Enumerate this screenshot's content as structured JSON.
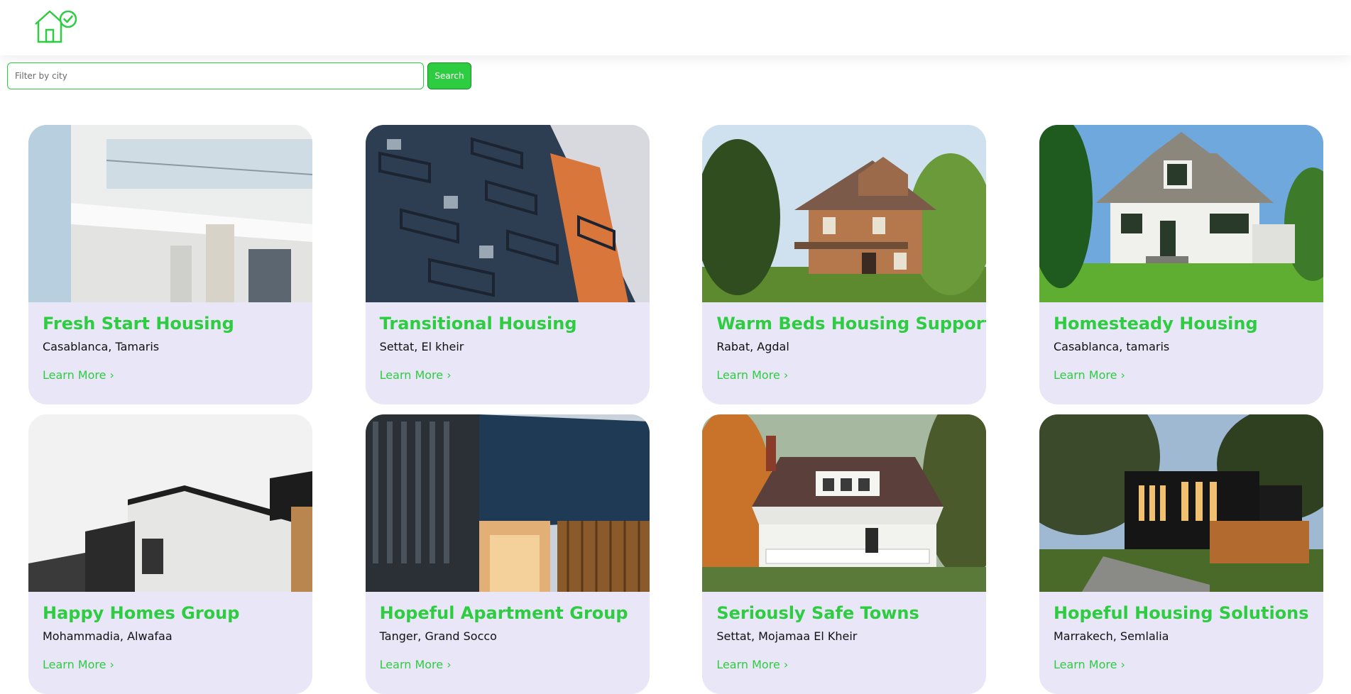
{
  "header": {
    "logo_icon": "house-check-icon",
    "brand_color": "#2ecc40"
  },
  "filter": {
    "placeholder": "Filter by city",
    "value": "",
    "search_label": "Search"
  },
  "cards": [
    {
      "title": "Fresh Start Housing",
      "location": "Casablanca, Tamaris",
      "link": "Learn More ›",
      "image": "modern-white-balcony-building-photo"
    },
    {
      "title": "Transitional Housing",
      "location": "Settat, El kheir",
      "link": "Learn More ›",
      "image": "blue-orange-apartment-balconies-photo"
    },
    {
      "title": "Warm Beds Housing Support",
      "location": "Rabat, Agdal",
      "link": "Learn More ›",
      "image": "victorian-brick-house-photo"
    },
    {
      "title": "Homesteady Housing",
      "location": "Casablanca, tamaris",
      "link": "Learn More ›",
      "image": "white-cottage-house-photo"
    },
    {
      "title": "Happy Homes Group",
      "location": "Mohammadia, Alwafaa",
      "link": "Learn More ›",
      "image": "white-black-modern-house-photo"
    },
    {
      "title": "Hopeful Apartment Group",
      "location": "Tanger, Grand Socco",
      "link": "Learn More ›",
      "image": "dark-blue-modern-apartment-photo"
    },
    {
      "title": "Seriously Safe Towns",
      "location": "Settat, Mojamaa El Kheir",
      "link": "Learn More ›",
      "image": "white-porch-house-autumn-photo"
    },
    {
      "title": "Hopeful Housing Solutions",
      "location": "Marrakech, Semlalia",
      "link": "Learn More ›",
      "image": "black-modern-house-night-photo"
    }
  ]
}
